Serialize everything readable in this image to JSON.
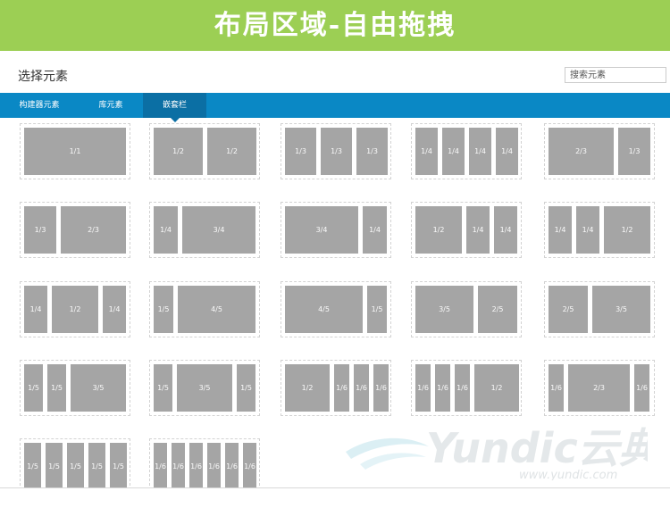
{
  "banner": {
    "title": "布局区域-自由拖拽"
  },
  "header": {
    "title": "选择元素",
    "search_placeholder": "搜索元素"
  },
  "tabs": [
    {
      "label": "构建器元素",
      "active": false
    },
    {
      "label": "库元素",
      "active": false
    },
    {
      "label": "嵌套栏",
      "active": true
    }
  ],
  "layouts": [
    [
      [
        "1/1"
      ],
      [
        "1/2",
        "1/2"
      ],
      [
        "1/3",
        "1/3",
        "1/3"
      ],
      [
        "1/4",
        "1/4",
        "1/4",
        "1/4"
      ],
      [
        "2/3",
        "1/3"
      ]
    ],
    [
      [
        "1/3",
        "2/3"
      ],
      [
        "1/4",
        "3/4"
      ],
      [
        "3/4",
        "1/4"
      ],
      [
        "1/2",
        "1/4",
        "1/4"
      ],
      [
        "1/4",
        "1/4",
        "1/2"
      ]
    ],
    [
      [
        "1/4",
        "1/2",
        "1/4"
      ],
      [
        "1/5",
        "4/5"
      ],
      [
        "4/5",
        "1/5"
      ],
      [
        "3/5",
        "2/5"
      ],
      [
        "2/5",
        "3/5"
      ]
    ],
    [
      [
        "1/5",
        "1/5",
        "3/5"
      ],
      [
        "1/5",
        "3/5",
        "1/5"
      ],
      [
        "1/2",
        "1/6",
        "1/6",
        "1/6"
      ],
      [
        "1/6",
        "1/6",
        "1/6",
        "1/2"
      ],
      [
        "1/6",
        "2/3",
        "1/6"
      ]
    ],
    [
      [
        "1/5",
        "1/5",
        "1/5",
        "1/5",
        "1/5"
      ],
      [
        "1/6",
        "1/6",
        "1/6",
        "1/6",
        "1/6",
        "1/6"
      ]
    ]
  ],
  "watermark": {
    "brand": "Yundic云典",
    "url": "www.yundic.com"
  },
  "colors": {
    "banner": "#9ccf54",
    "tabbar": "#0a88c5",
    "tab_active": "#0b6fa4",
    "column": "#a5a5a5"
  }
}
